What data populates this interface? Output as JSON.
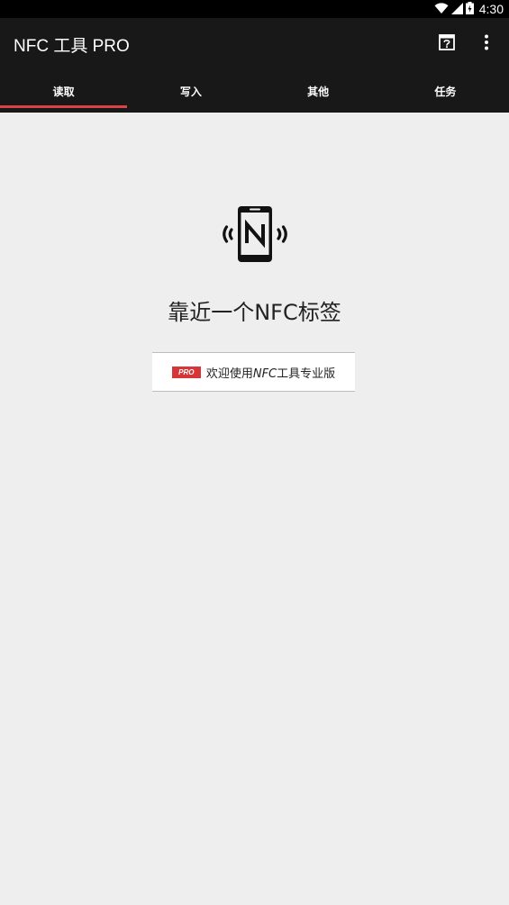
{
  "status_bar": {
    "time": "4:30"
  },
  "app_bar": {
    "title": "NFC 工具 PRO",
    "help_icon": "help-icon",
    "more_icon": "more-vert-icon"
  },
  "tabs": [
    {
      "label": "读取",
      "selected": true
    },
    {
      "label": "写入",
      "selected": false
    },
    {
      "label": "其他",
      "selected": false
    },
    {
      "label": "任务",
      "selected": false
    }
  ],
  "main": {
    "icon": "nfc-phone-icon",
    "instruction": "靠近一个NFC标签",
    "banner": {
      "badge": "PRO",
      "text_prefix": "欢迎使用",
      "text_italic": "NFC",
      "text_suffix": "工具专业版"
    }
  },
  "colors": {
    "accent": "#d84347",
    "app_bar": "#181818",
    "background": "#eeeeee"
  }
}
